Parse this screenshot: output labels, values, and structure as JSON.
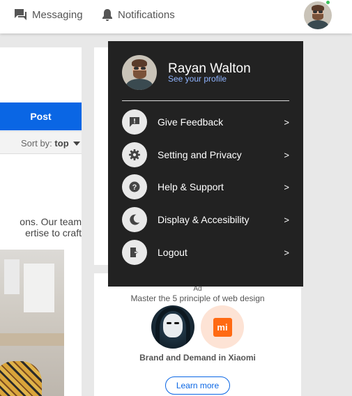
{
  "topbar": {
    "messaging_label": "Messaging",
    "notifications_label": "Notifications",
    "messaging_icon": "chat-bubble-icon",
    "notifications_icon": "bell-icon",
    "online_status_color": "#3cc15a"
  },
  "feed": {
    "post_button_label": "Post",
    "sort_prefix": "Sort by:",
    "sort_value": "top",
    "post_text_line1": "ons. Our team",
    "post_text_line2": "ertise to craft",
    "accent_color": "#0a66e4"
  },
  "menu": {
    "user_name": "Rayan Walton",
    "profile_link": "See your profile",
    "items": [
      {
        "label": "Give Feedback",
        "icon": "feedback-icon",
        "chevron": ">"
      },
      {
        "label": "Setting and Privacy",
        "icon": "gear-icon",
        "chevron": ">"
      },
      {
        "label": "Help & Support",
        "icon": "help-icon",
        "chevron": ">"
      },
      {
        "label": "Display & Accesibility",
        "icon": "moon-icon",
        "chevron": ">"
      },
      {
        "label": "Logout",
        "icon": "logout-icon",
        "chevron": ">"
      }
    ]
  },
  "ad": {
    "label": "Ad",
    "title": "Master the 5 principle of web design",
    "logo_text": "mi",
    "brand_text": "Brand and Demand in Xiaomi",
    "cta_label": "Learn more"
  }
}
